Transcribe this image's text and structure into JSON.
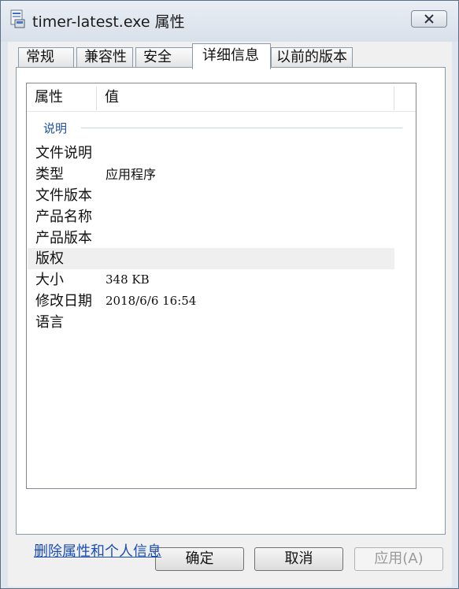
{
  "window": {
    "title": "timer-latest.exe 属性",
    "icons": [
      "app-icon",
      "close-icon"
    ]
  },
  "tabs": [
    {
      "label": "常规",
      "active": false
    },
    {
      "label": "兼容性",
      "active": false
    },
    {
      "label": "安全",
      "active": false
    },
    {
      "label": "详细信息",
      "active": true
    },
    {
      "label": "以前的版本",
      "active": false
    }
  ],
  "details": {
    "columns": [
      "属性",
      "值"
    ],
    "group": "说明",
    "rows": [
      {
        "property": "文件说明",
        "value": ""
      },
      {
        "property": "类型",
        "value": "应用程序"
      },
      {
        "property": "文件版本",
        "value": ""
      },
      {
        "property": "产品名称",
        "value": ""
      },
      {
        "property": "产品版本",
        "value": ""
      },
      {
        "property": "版权",
        "value": "",
        "highlighted": true
      },
      {
        "property": "大小",
        "value": "348 KB"
      },
      {
        "property": "修改日期",
        "value": "2018/6/6 16:54"
      },
      {
        "property": "语言",
        "value": ""
      }
    ]
  },
  "remove_link": "删除属性和个人信息",
  "buttons": {
    "ok": "确定",
    "cancel": "取消",
    "apply": "应用(A)",
    "apply_enabled": false
  },
  "colors": {
    "group_label": "#1e4fa1",
    "link": "#1a4db5",
    "highlight_row": "#efefef"
  }
}
